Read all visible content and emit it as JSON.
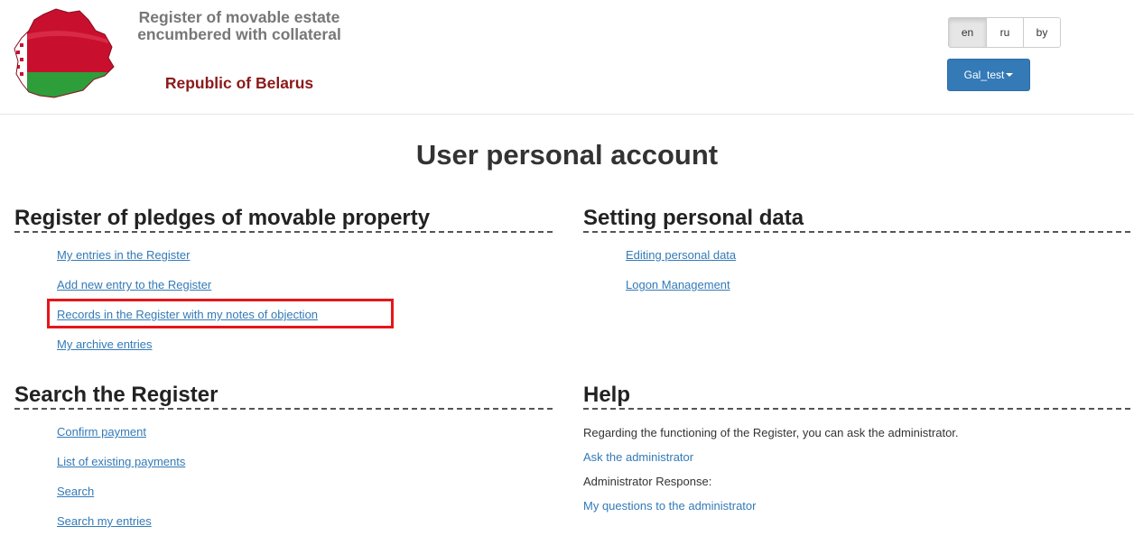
{
  "header": {
    "title": "Register of movable estate encumbered with collateral",
    "subtitle": "Republic of Belarus",
    "languages": [
      {
        "label": "en",
        "active": true
      },
      {
        "label": "ru",
        "active": false
      },
      {
        "label": "by",
        "active": false
      }
    ],
    "user_menu_label": "Gal_test",
    "colors": {
      "flag_red": "#c8102e",
      "flag_green": "#2e9e3a",
      "primary_button": "#337ab7",
      "highlight": "#e5161b"
    }
  },
  "main": {
    "page_title": "User personal account",
    "sections": {
      "pledges": {
        "heading": "Register of pledges of movable property",
        "links": [
          "My entries in the Register",
          "Add new entry to the Register",
          "Records in the Register with my notes of objection",
          "My archive entries"
        ]
      },
      "personal": {
        "heading": "Setting personal data",
        "links": [
          "Editing personal data",
          "Logon Management"
        ]
      },
      "search": {
        "heading": "Search the Register",
        "links": [
          "Confirm payment",
          "List of existing payments",
          "Search",
          "Search my entries"
        ]
      },
      "help": {
        "heading": "Help",
        "intro": "Regarding the functioning of the Register, you can ask the administrator.",
        "ask_link": "Ask the administrator",
        "response_label": "Administrator Response:",
        "questions_link": "My questions to the administrator"
      }
    }
  }
}
